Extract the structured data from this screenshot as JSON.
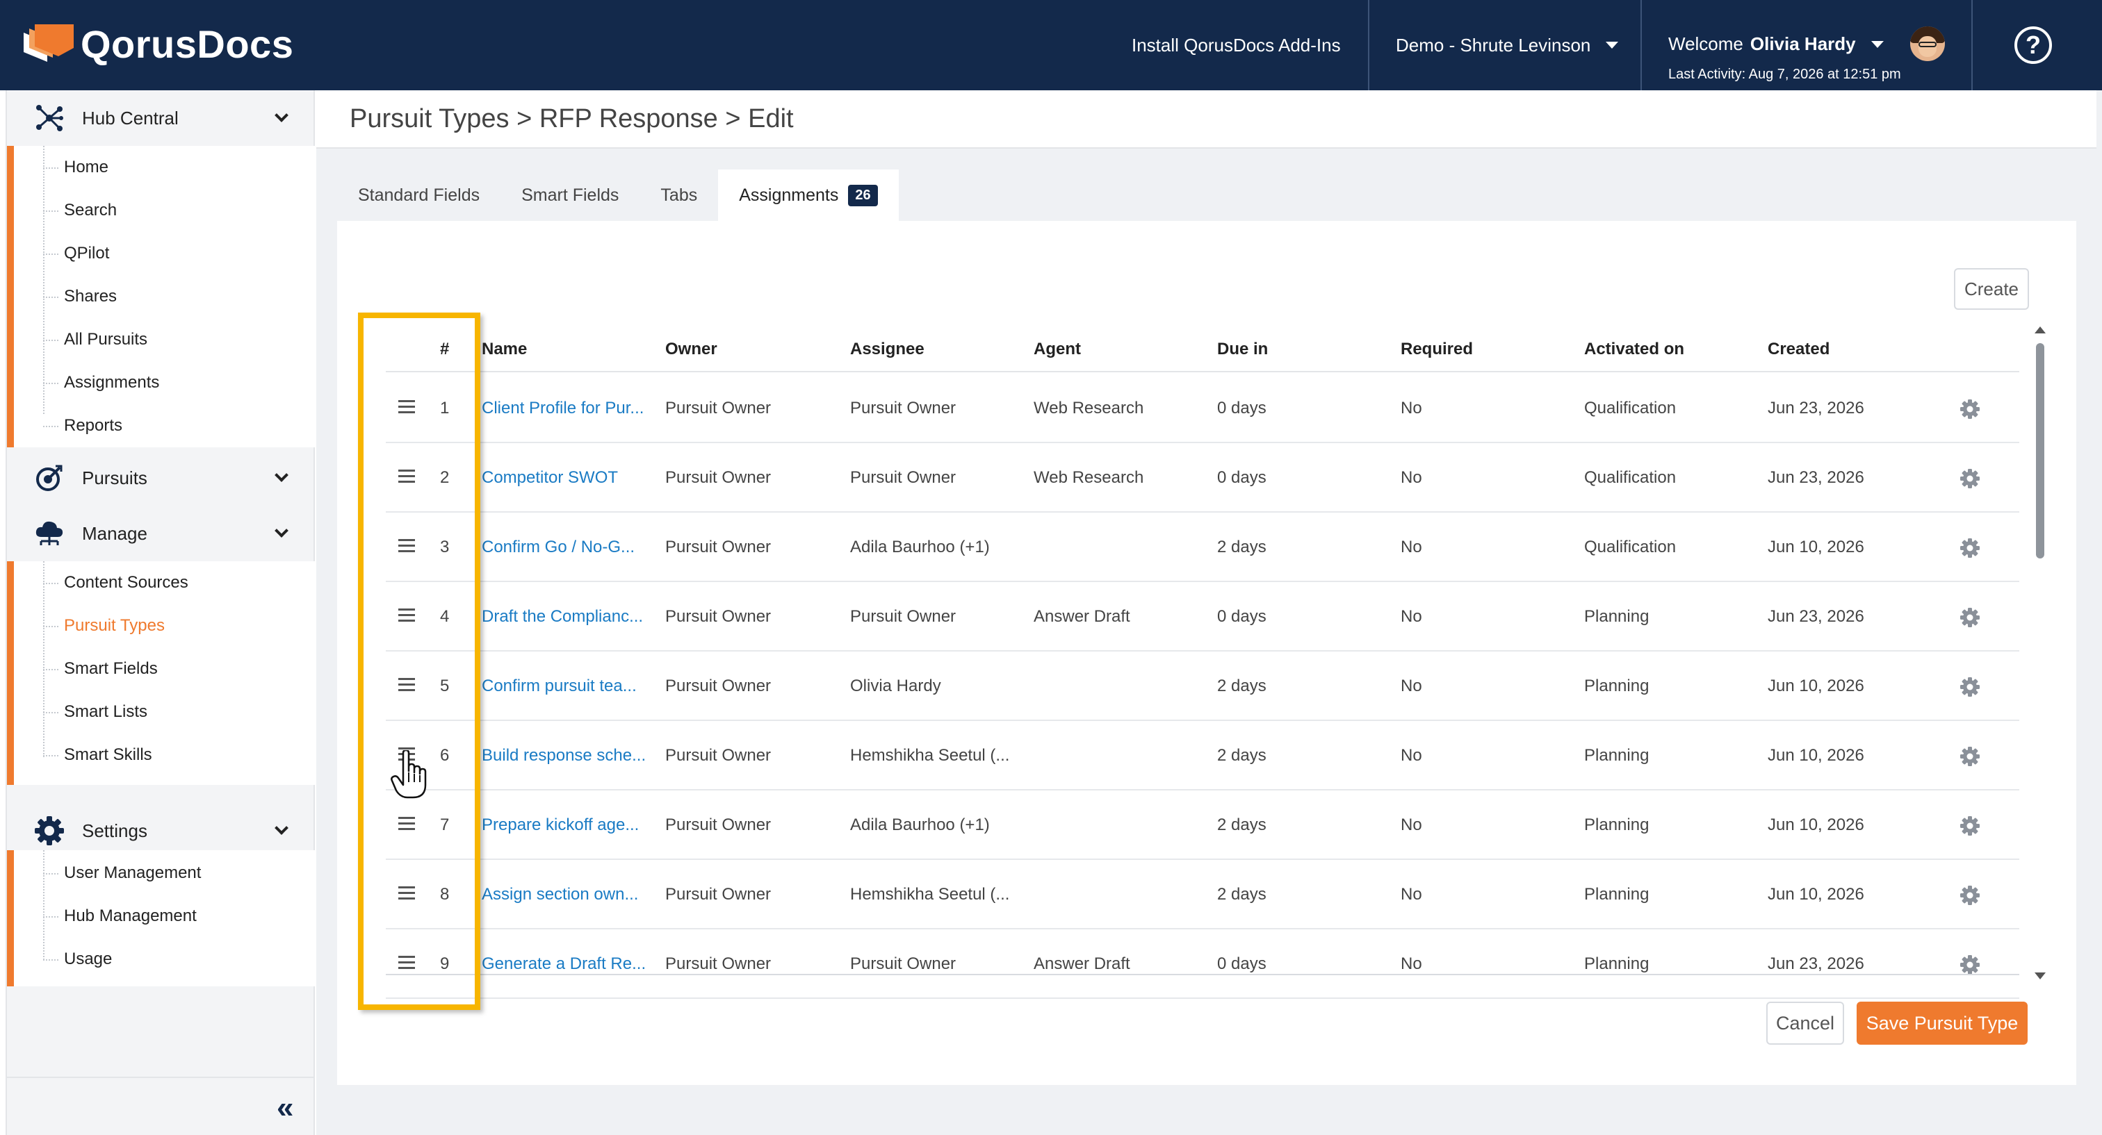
{
  "app": {
    "logo_text": "QorusDocs"
  },
  "header": {
    "install_link": "Install QorusDocs Add-Ins",
    "workspace": "Demo - Shrute Levinson",
    "welcome_prefix": "Welcome",
    "user_name": "Olivia Hardy",
    "last_activity": "Last Activity: Aug 7, 2026 at 12:51 pm",
    "help_glyph": "?"
  },
  "sidebar": {
    "groups": [
      {
        "label": "Hub Central",
        "icon": "hub-icon"
      },
      {
        "label": "Pursuits",
        "icon": "target-icon"
      },
      {
        "label": "Manage",
        "icon": "cloud-icon"
      },
      {
        "label": "Settings",
        "icon": "gear-icon"
      }
    ],
    "hub_items": [
      "Home",
      "Search",
      "QPilot",
      "Shares",
      "All Pursuits",
      "Assignments",
      "Reports"
    ],
    "manage_items": [
      "Content Sources",
      "Pursuit Types",
      "Smart Fields",
      "Smart Lists",
      "Smart Skills"
    ],
    "settings_items": [
      "User Management",
      "Hub Management",
      "Usage"
    ],
    "collapse_glyph": "«"
  },
  "breadcrumb": "Pursuit Types > RFP Response > Edit",
  "tabs": {
    "standard": "Standard Fields",
    "smart": "Smart Fields",
    "tabs": "Tabs",
    "assignments": "Assignments",
    "assignments_count": "26"
  },
  "buttons": {
    "create": "Create",
    "cancel": "Cancel",
    "save": "Save Pursuit Type"
  },
  "table": {
    "headers": {
      "num": "#",
      "name": "Name",
      "owner": "Owner",
      "assignee": "Assignee",
      "agent": "Agent",
      "due": "Due in",
      "required": "Required",
      "activated": "Activated on",
      "created": "Created"
    },
    "rows": [
      {
        "num": "1",
        "name": "Client Profile for Pur...",
        "owner": "Pursuit Owner",
        "assignee": "Pursuit Owner",
        "agent": "Web Research",
        "due": "0 days",
        "required": "No",
        "activated": "Qualification",
        "created": "Jun 23, 2026"
      },
      {
        "num": "2",
        "name": "Competitor SWOT",
        "owner": "Pursuit Owner",
        "assignee": "Pursuit Owner",
        "agent": "Web Research",
        "due": "0 days",
        "required": "No",
        "activated": "Qualification",
        "created": "Jun 23, 2026"
      },
      {
        "num": "3",
        "name": "Confirm Go / No-G...",
        "owner": "Pursuit Owner",
        "assignee": "Adila Baurhoo (+1)",
        "agent": "",
        "due": "2 days",
        "required": "No",
        "activated": "Qualification",
        "created": "Jun 10, 2026"
      },
      {
        "num": "4",
        "name": "Draft the Complianc...",
        "owner": "Pursuit Owner",
        "assignee": "Pursuit Owner",
        "agent": "Answer Draft",
        "due": "0 days",
        "required": "No",
        "activated": "Planning",
        "created": "Jun 23, 2026"
      },
      {
        "num": "5",
        "name": "Confirm pursuit tea...",
        "owner": "Pursuit Owner",
        "assignee": "Olivia Hardy",
        "agent": "",
        "due": "2 days",
        "required": "No",
        "activated": "Planning",
        "created": "Jun 10, 2026"
      },
      {
        "num": "6",
        "name": "Build response sche...",
        "owner": "Pursuit Owner",
        "assignee": "Hemshikha Seetul (...",
        "agent": "",
        "due": "2 days",
        "required": "No",
        "activated": "Planning",
        "created": "Jun 10, 2026"
      },
      {
        "num": "7",
        "name": "Prepare kickoff age...",
        "owner": "Pursuit Owner",
        "assignee": "Adila Baurhoo (+1)",
        "agent": "",
        "due": "2 days",
        "required": "No",
        "activated": "Planning",
        "created": "Jun 10, 2026"
      },
      {
        "num": "8",
        "name": "Assign section own...",
        "owner": "Pursuit Owner",
        "assignee": "Hemshikha Seetul (...",
        "agent": "",
        "due": "2 days",
        "required": "No",
        "activated": "Planning",
        "created": "Jun 10, 2026"
      },
      {
        "num": "9",
        "name": "Generate a Draft Re...",
        "owner": "Pursuit Owner",
        "assignee": "Pursuit Owner",
        "agent": "Answer Draft",
        "due": "0 days",
        "required": "No",
        "activated": "Planning",
        "created": "Jun 23, 2026"
      }
    ]
  },
  "colors": {
    "header_bg": "#13294b",
    "accent": "#ef7a2e",
    "link": "#1a7bc4",
    "highlight": "#f7b500"
  }
}
